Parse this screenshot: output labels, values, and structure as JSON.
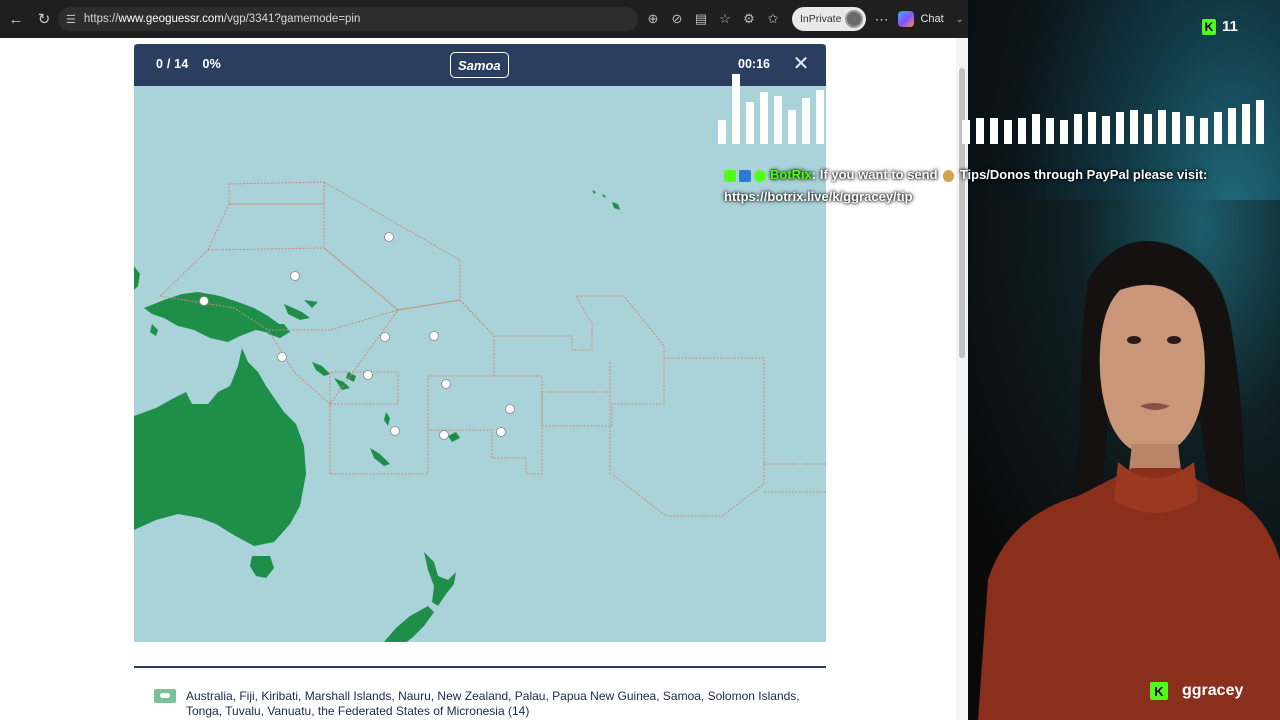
{
  "browser": {
    "url_prefix": "https://",
    "url_host": "www.geoguessr.com",
    "url_path": "/vgp/3341?gamemode=pin",
    "inprivate_label": "InPrivate",
    "chat_label": "Chat"
  },
  "game": {
    "score_count": "0 / 14",
    "score_percent": "0%",
    "target_country": "Samoa",
    "timer": "00:16",
    "colors": {
      "header": "#2a3f60",
      "ocean": "#aad3d9",
      "land": "#1e8e49",
      "border": "#c98c78"
    }
  },
  "footer": {
    "countries_text": "Australia, Fiji, Kiribati, Marshall Islands, Nauru, New Zealand, Palau, Papua New Guinea, Samoa, Solomon Islands, Tonga, Tuvalu, Vanuatu, the Federated States of Micronesia (14)"
  },
  "stream": {
    "viewer_count": "11",
    "chat": {
      "username": "BotRix",
      "message_part1": ": If you want to send",
      "message_part2": "Tips/Donos through PayPal please visit:",
      "link": "https://botrix.live/k/ggracey/tip"
    },
    "streamer_name": "ggracey",
    "colors": {
      "kick_green": "#53fc18"
    }
  }
}
